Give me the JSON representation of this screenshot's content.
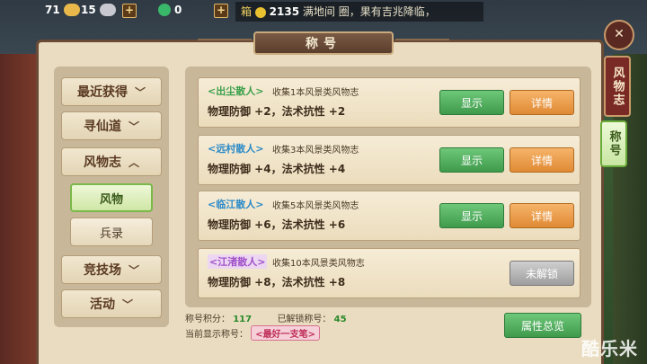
{
  "resources": [
    {
      "value": "71",
      "icon": "gold-ingot-icon",
      "color": "#e8b84a"
    },
    {
      "value": "15",
      "icon": "silver-ingot-icon",
      "color": "#c8c8d0"
    },
    {
      "value": "0",
      "icon": "jade-icon",
      "color": "#3ab86a"
    }
  ],
  "ticker": {
    "prefix": "箱",
    "amount": "2135",
    "text": "满地间 圈，果有吉兆降临，"
  },
  "title": "称号",
  "nav": {
    "recent": "最近获得",
    "seek": "寻仙道",
    "scenery": "风物志",
    "sub_scenery": "风物",
    "sub_soldier": "兵录",
    "arena": "竞技场",
    "activity": "活动"
  },
  "cards": [
    {
      "name": "<出尘散人>",
      "name_color": "#3aa04a",
      "desc": "收集1本风景类风物志",
      "stats": "物理防御 +2，法术抗性 +2",
      "show": "显示",
      "detail": "详情",
      "locked": false
    },
    {
      "name": "<远村散人>",
      "name_color": "#2a8ac8",
      "desc": "收集3本风景类风物志",
      "stats": "物理防御 +4，法术抗性 +4",
      "show": "显示",
      "detail": "详情",
      "locked": false
    },
    {
      "name": "<临江散人>",
      "name_color": "#2a8ac8",
      "desc": "收集5本风景类风物志",
      "stats": "物理防御 +6，法术抗性 +6",
      "show": "显示",
      "detail": "详情",
      "locked": false
    },
    {
      "name": "<江渚散人>",
      "name_color": "#a050c8",
      "desc": "收集10本风景类风物志",
      "stats": "物理防御 +8，法术抗性 +8",
      "lock_label": "未解锁",
      "locked": true
    }
  ],
  "footer": {
    "score_label": "称号积分：",
    "score": "117",
    "unlocked_label": "已解锁称号：",
    "unlocked": "45",
    "current_label": "当前显示称号：",
    "current": "<最好一支笔>",
    "attr_button": "属性总览"
  },
  "right_tabs": {
    "scenery": "风物志",
    "title": "称号"
  },
  "watermark": "酷乐米"
}
